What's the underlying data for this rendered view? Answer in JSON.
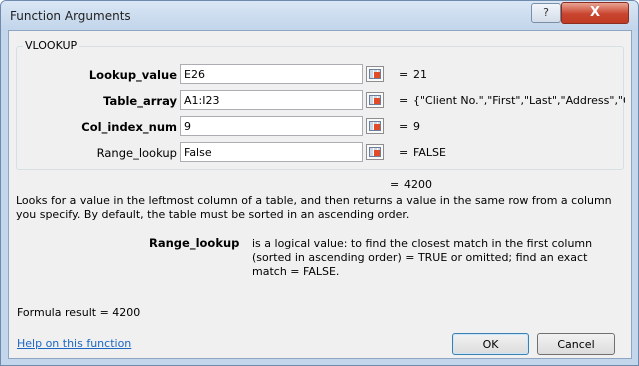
{
  "window": {
    "title": "Function Arguments",
    "help_glyph": "?",
    "close_glyph": "X"
  },
  "function_name": "VLOOKUP",
  "arguments": [
    {
      "label": "Lookup_value",
      "bold": true,
      "value": "E26",
      "result": "21"
    },
    {
      "label": "Table_array",
      "bold": true,
      "value": "A1:I23",
      "result": "{\"Client No.\",\"First\",\"Last\",\"Address\",\"Ci"
    },
    {
      "label": "Col_index_num",
      "bold": true,
      "value": "9",
      "result": "9"
    },
    {
      "label": "Range_lookup",
      "bold": false,
      "value": "False",
      "result": "FALSE"
    }
  ],
  "equals_sign": "=",
  "function_result": "4200",
  "description": "Looks for a value in the leftmost column of a table, and then returns a value in the same row from a column you specify. By default, the table must be sorted in an ascending order.",
  "arg_help": {
    "name": "Range_lookup",
    "text": "is a logical value: to find the closest match in the first column (sorted in ascending order) = TRUE or omitted; find an exact match = FALSE."
  },
  "formula_result": "Formula result =   4200",
  "help_link": "Help on this function",
  "buttons": {
    "ok": "OK",
    "cancel": "Cancel"
  },
  "icons": {
    "cell_picker": "collapse-dialog-icon"
  }
}
